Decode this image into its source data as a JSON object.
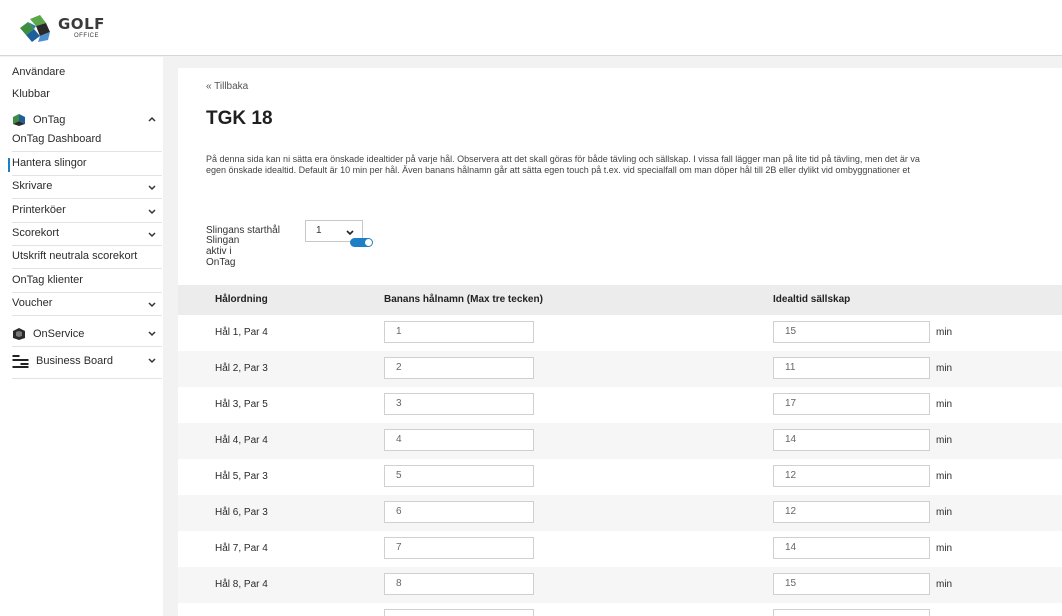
{
  "header": {
    "logo_text": "GOLF",
    "logo_subtext": "OFFICE"
  },
  "sidebar": {
    "top_items": [
      "Användare",
      "Klubbar"
    ],
    "ontag": {
      "label": "OnTag",
      "items": [
        {
          "label": "OnTag Dashboard"
        },
        {
          "label": "Hantera slingor",
          "active": true
        },
        {
          "label": "Skrivare"
        },
        {
          "label": "Printerköer"
        },
        {
          "label": "Scorekort"
        },
        {
          "label": "Utskrift neutrala scorekort"
        },
        {
          "label": "OnTag klienter"
        },
        {
          "label": "Voucher"
        }
      ]
    },
    "onservice": {
      "label": "OnService"
    },
    "business_board": {
      "label": "Business Board"
    }
  },
  "main": {
    "back_link": "« Tillbaka",
    "title": "TGK 18",
    "description_line1": "På denna sida kan ni sätta era önskade idealtider på varje hål. Observera att det skall göras för både tävling och sällskap. I vissa fall lägger man på lite tid på tävling, men det är va",
    "description_line2": "egen önskade idealtid. Default är 10 min per hål. Även banans hålnamn går att sätta egen touch på t.ex. vid specialfall om man döper hål till 2B eller dylikt vid ombyggnationer et",
    "start_hole_label": "Slingans starthål",
    "start_hole_value": "1",
    "active_label": "Slingan aktiv i OnTag",
    "active": true,
    "table": {
      "col_hole": "Hålordning",
      "col_name": "Banans hålnamn (Max tre tecken)",
      "col_time": "Idealtid sällskap",
      "unit": "min",
      "rows": [
        {
          "hole": "Hål 1, Par 4",
          "name": "1",
          "time": "15"
        },
        {
          "hole": "Hål 2, Par 3",
          "name": "2",
          "time": "11"
        },
        {
          "hole": "Hål 3, Par 5",
          "name": "3",
          "time": "17"
        },
        {
          "hole": "Hål 4, Par 4",
          "name": "4",
          "time": "14"
        },
        {
          "hole": "Hål 5, Par 3",
          "name": "5",
          "time": "12"
        },
        {
          "hole": "Hål 6, Par 3",
          "name": "6",
          "time": "12"
        },
        {
          "hole": "Hål 7, Par 4",
          "name": "7",
          "time": "14"
        },
        {
          "hole": "Hål 8, Par 4",
          "name": "8",
          "time": "15"
        }
      ]
    }
  },
  "colors": {
    "accent": "#1d7fc5",
    "header_row": "#ececec",
    "alt_row": "#f6f6f6"
  }
}
